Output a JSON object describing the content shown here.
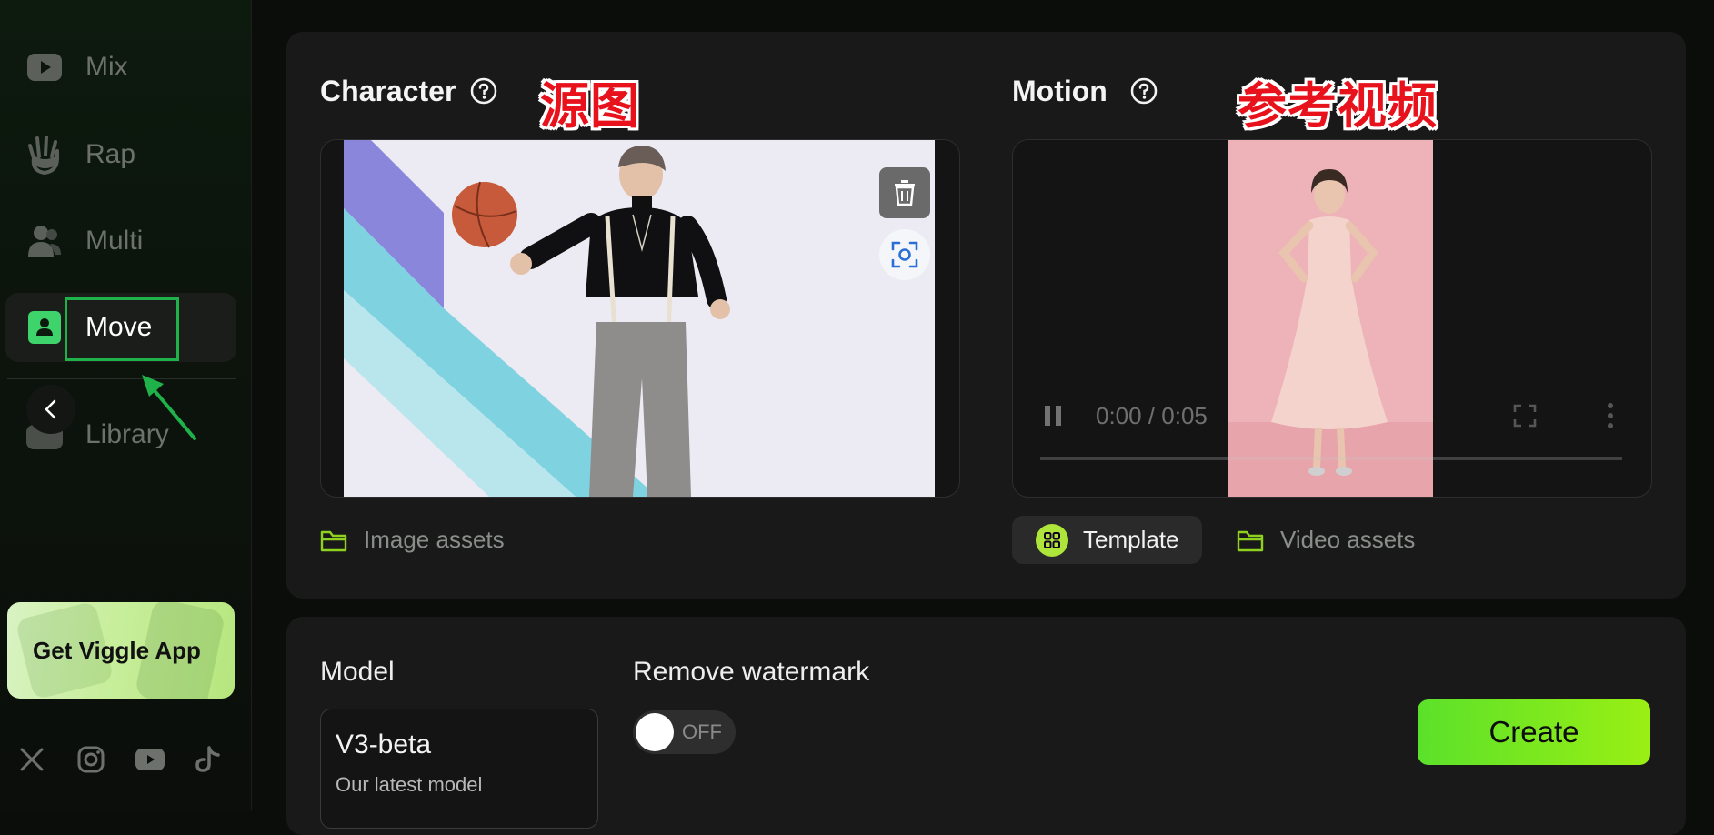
{
  "sidebar": {
    "items": [
      {
        "label": "Mix",
        "icon": "play-icon"
      },
      {
        "label": "Rap",
        "icon": "hand-icon"
      },
      {
        "label": "Multi",
        "icon": "users-icon"
      },
      {
        "label": "Move",
        "icon": "person-icon",
        "active": true
      },
      {
        "label": "Library",
        "icon": "library-icon"
      }
    ],
    "app_card": {
      "title": "Get Viggle App"
    },
    "social": [
      "x-icon",
      "instagram-icon",
      "youtube-icon",
      "tiktok-icon"
    ],
    "highlight_color": "#1fb24a"
  },
  "character": {
    "title": "Character",
    "annotation": "源图",
    "asset_link": "Image assets"
  },
  "motion": {
    "title": "Motion",
    "annotation": "参考视频",
    "video_time": "0:00 / 0:05",
    "template_label": "Template",
    "asset_link": "Video assets"
  },
  "settings": {
    "model_label": "Model",
    "model_name": "V3-beta",
    "model_desc": "Our latest model",
    "watermark_label": "Remove watermark",
    "watermark_state": "OFF",
    "create_label": "Create"
  },
  "colors": {
    "accent_green": "#9aef14",
    "annotation_red": "#e8121c"
  }
}
